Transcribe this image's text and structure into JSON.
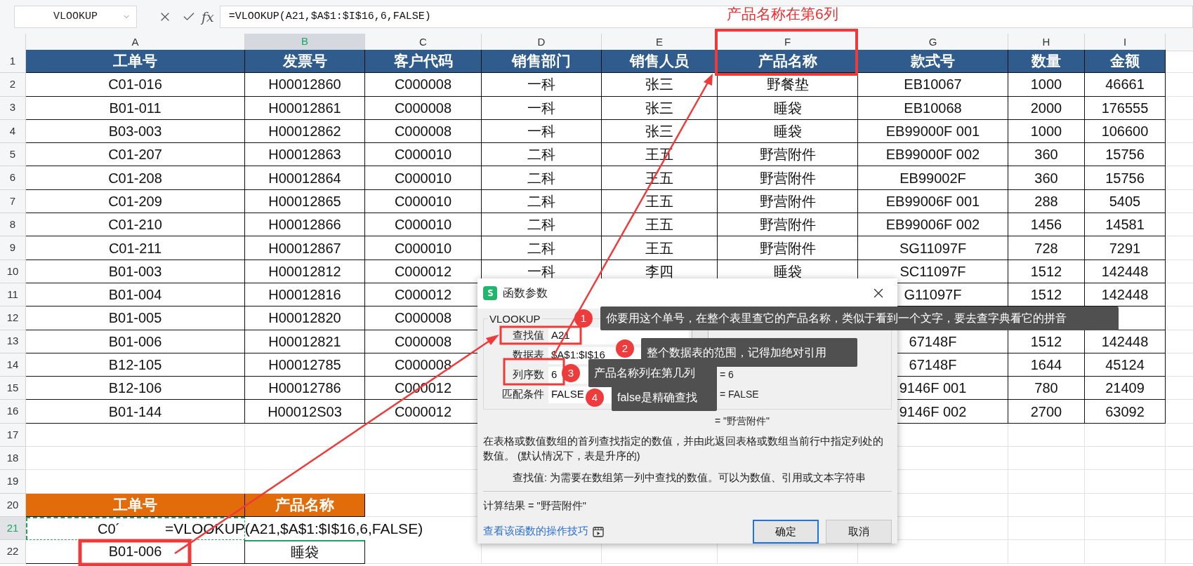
{
  "name_box": "VLOOKUP",
  "fx_label": "fx",
  "formula": "=VLOOKUP(A21,$A$1:$I$16,6,FALSE)",
  "annotation": {
    "title": "产品名称在第6列"
  },
  "columns": [
    {
      "label": "A",
      "selected": false
    },
    {
      "label": "B",
      "selected": true
    },
    {
      "label": "C",
      "selected": false
    },
    {
      "label": "D",
      "selected": false
    },
    {
      "label": "E",
      "selected": false
    },
    {
      "label": "F",
      "selected": false
    },
    {
      "label": "G",
      "selected": false
    },
    {
      "label": "H",
      "selected": false
    },
    {
      "label": "I",
      "selected": false
    }
  ],
  "rows": [
    {
      "number": "1",
      "selected": false,
      "kind": "table_header",
      "cells": [
        "工单号",
        "发票号",
        "客户代码",
        "销售部门",
        "销售人员",
        "产品名称",
        "款式号",
        "数量",
        "金额"
      ]
    },
    {
      "number": "2",
      "selected": false,
      "kind": "table_row",
      "cells": [
        "C01-016",
        "H00012860",
        "C000008",
        "一科",
        "张三",
        "野餐垫",
        "EB10067",
        "1000",
        "46661"
      ]
    },
    {
      "number": "3",
      "selected": false,
      "kind": "table_row",
      "cells": [
        "B01-011",
        "H00012861",
        "C000008",
        "一科",
        "张三",
        "睡袋",
        "EB10068",
        "2000",
        "176555"
      ]
    },
    {
      "number": "4",
      "selected": false,
      "kind": "table_row",
      "cells": [
        "B03-003",
        "H00012862",
        "C000008",
        "一科",
        "张三",
        "睡袋",
        "EB99000F 001",
        "1000",
        "106600"
      ]
    },
    {
      "number": "5",
      "selected": false,
      "kind": "table_row",
      "cells": [
        "C01-207",
        "H00012863",
        "C000010",
        "二科",
        "王五",
        "野营附件",
        "EB99000F 002",
        "360",
        "15756"
      ]
    },
    {
      "number": "6",
      "selected": false,
      "kind": "table_row",
      "cells": [
        "C01-208",
        "H00012864",
        "C000010",
        "二科",
        "王五",
        "野营附件",
        "EB99002F",
        "360",
        "15756"
      ]
    },
    {
      "number": "7",
      "selected": false,
      "kind": "table_row",
      "cells": [
        "C01-209",
        "H00012865",
        "C000010",
        "二科",
        "王五",
        "野营附件",
        "EB99006F 001",
        "288",
        "5405"
      ]
    },
    {
      "number": "8",
      "selected": false,
      "kind": "table_row",
      "cells": [
        "C01-210",
        "H00012866",
        "C000010",
        "二科",
        "王五",
        "野营附件",
        "EB99006F 002",
        "1456",
        "14581"
      ]
    },
    {
      "number": "9",
      "selected": false,
      "kind": "table_row",
      "cells": [
        "C01-211",
        "H00012867",
        "C000010",
        "二科",
        "王五",
        "野营附件",
        "SG11097F",
        "728",
        "7291"
      ]
    },
    {
      "number": "10",
      "selected": false,
      "kind": "table_row",
      "cells": [
        "B01-003",
        "H00012812",
        "C000012",
        "一科",
        "李四",
        "睡袋",
        "SC11097F",
        "1512",
        "142448"
      ]
    },
    {
      "number": "11",
      "selected": false,
      "kind": "table_row",
      "cells": [
        "B01-004",
        "H00012816",
        "C000012",
        null,
        null,
        null,
        "G11097F",
        "1512",
        "142448"
      ]
    },
    {
      "number": "12",
      "selected": false,
      "kind": "table_row",
      "cells": [
        "B01-005",
        "H00012820",
        "C000008",
        null,
        null,
        null,
        null,
        null,
        null
      ]
    },
    {
      "number": "13",
      "selected": false,
      "kind": "table_row",
      "cells": [
        "B01-006",
        "H00012821",
        "C000008",
        null,
        null,
        null,
        "67148F",
        "1512",
        "142448"
      ]
    },
    {
      "number": "14",
      "selected": false,
      "kind": "table_row",
      "cells": [
        "B12-105",
        "H00012785",
        "C000008",
        null,
        null,
        null,
        "67148F",
        "1644",
        "45124"
      ]
    },
    {
      "number": "15",
      "selected": false,
      "kind": "table_row",
      "cells": [
        "B12-106",
        "H00012786",
        "C000012",
        null,
        null,
        null,
        "9146F 001",
        "780",
        "21409"
      ]
    },
    {
      "number": "16",
      "selected": false,
      "kind": "table_row",
      "cells": [
        "B01-144",
        "H00012S03",
        "C000012",
        null,
        null,
        null,
        "9146F 002",
        "2700",
        "63092"
      ]
    },
    {
      "number": "17",
      "selected": false,
      "kind": "empty"
    },
    {
      "number": "18",
      "selected": false,
      "kind": "empty"
    },
    {
      "number": "19",
      "selected": false,
      "kind": "empty"
    },
    {
      "number": "20",
      "selected": false,
      "kind": "lookup_header",
      "cells": [
        "工单号",
        "产品名称"
      ]
    },
    {
      "number": "21",
      "selected": true,
      "kind": "lookup_input",
      "cells": [
        "C0´"
      ],
      "formula": "=VLOOKUP(A21,$A$1:$I$16,6,FALSE)"
    },
    {
      "number": "22",
      "selected": false,
      "kind": "lookup_row",
      "cells": [
        "B01-006",
        "睡袋"
      ]
    }
  ],
  "dialog": {
    "title": "函数参数",
    "group_label": "VLOOKUP",
    "args": [
      {
        "label": "查找值",
        "value": "A21"
      },
      {
        "label": "数据表",
        "value": "$A$1:$I$16"
      },
      {
        "label": "列序数",
        "value": "6",
        "result": "= 6"
      },
      {
        "label": "匹配条件",
        "value": "FALSE",
        "result": "= FALSE"
      }
    ],
    "result_line": "= \"野营附件\"",
    "description": "在表格或数值数组的首列查找指定的数值，并由此返回表格或数组当前行中指定列处的数值。 (默认情况下，表是升序的)",
    "arg_help": "查找值:  为需要在数组第一列中查找的数值。可以为数值、引用或文本字符串",
    "calc_result": "计算结果 = \"野营附件\"",
    "link": "查看该函数的操作技巧",
    "buttons": [
      {
        "label": "确定",
        "selected": true
      },
      {
        "label": "取消",
        "selected": false
      }
    ],
    "tooltips": [
      {
        "number": "1",
        "text": "你要用这个单号，在整个表里查它的产品名称，类似于看到一个文字，要去查字典看它的拼音"
      },
      {
        "number": "2",
        "text": "整个数据表的范围，记得加绝对引用"
      },
      {
        "number": "3",
        "text": "产品名称列在第几列"
      },
      {
        "number": "4",
        "text": "false是精确查找"
      }
    ]
  }
}
